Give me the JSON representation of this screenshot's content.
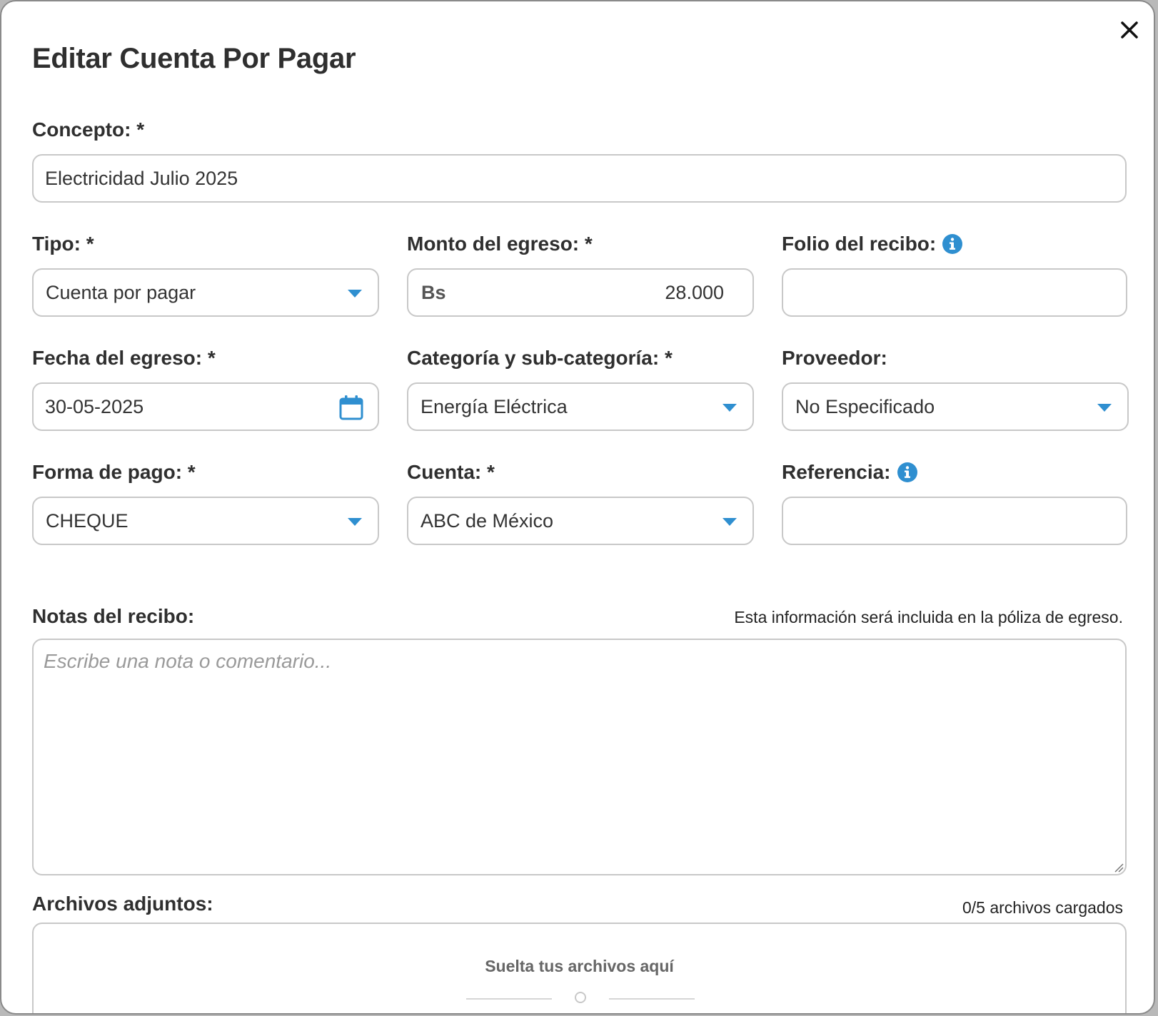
{
  "modal": {
    "title": "Editar Cuenta Por Pagar"
  },
  "concepto": {
    "label": "Concepto: *",
    "value": "Electricidad Julio 2025"
  },
  "tipo": {
    "label": "Tipo: *",
    "value": "Cuenta por pagar"
  },
  "monto": {
    "label": "Monto del egreso: *",
    "currency": "Bs",
    "value": "28.000"
  },
  "folio": {
    "label": "Folio del recibo:",
    "value": ""
  },
  "fecha": {
    "label": "Fecha del egreso: *",
    "value": "30-05-2025"
  },
  "categoria": {
    "label": "Categoría y sub-categoría: *",
    "value": "Energía Eléctrica"
  },
  "proveedor": {
    "label": "Proveedor:",
    "value": "No Especificado"
  },
  "forma_pago": {
    "label": "Forma de pago: *",
    "value": "CHEQUE"
  },
  "cuenta": {
    "label": "Cuenta: *",
    "value": "ABC de México"
  },
  "referencia": {
    "label": "Referencia:",
    "value": ""
  },
  "notas": {
    "label": "Notas del recibo:",
    "hint": "Esta información será incluida en la póliza de egreso.",
    "placeholder": "Escribe una nota o comentario..."
  },
  "adjuntos": {
    "label": "Archivos adjuntos:",
    "count": "0/5 archivos cargados",
    "drop_text": "Suelta tus archivos aquí"
  },
  "colors": {
    "accent": "#2f8fd0",
    "text": "#2f2f2f",
    "border": "#c8c8c8"
  }
}
